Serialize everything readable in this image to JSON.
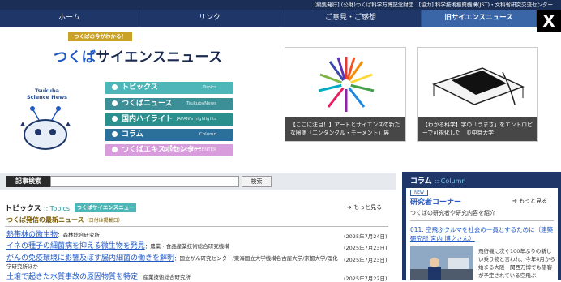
{
  "topbar": {
    "text": "[編集発行] (公財)つくば科学万博記念財団　[協力] 科学技術振興機構(JST)・文科省研究交流センター"
  },
  "nav": {
    "items": [
      "ホーム",
      "リンク",
      "ご意見・ご感想",
      "旧サイエンスニュース"
    ],
    "x_icon": "X"
  },
  "header": {
    "tagline": "つくばの今がわかる！",
    "title_a": "つくば",
    "title_b": "サイエンスニュース",
    "mascot_label_1": "Tsukuba",
    "mascot_label_2": "Science News"
  },
  "menu": [
    {
      "label": "トピックス",
      "en": "Topics"
    },
    {
      "label": "つくばニュース",
      "en": "TsukubaNews"
    },
    {
      "label": "国内ハイライト",
      "en": "JAPAN's highlights"
    },
    {
      "label": "コラム",
      "en": "Column"
    },
    {
      "label": "つくばエキスポセンター",
      "en": "TSUKUBA EXPO CENTER"
    }
  ],
  "features": [
    {
      "caption": "【ここに注目！】アートとサイエンスの新たな圏係「エンタングル・モーメント」展"
    },
    {
      "caption": "【わかる科学】字の「うまさ」をエントロピーで可視化した　©中京大学"
    }
  ],
  "search": {
    "label": "記事検索",
    "button": "検索",
    "placeholder": ""
  },
  "topics": {
    "title": "トピックス",
    "en": ":: Topics",
    "badge": "つくばサイエンスニュース",
    "more": "もっと見る",
    "subhead": "つくば発信の最新ニュース",
    "subhead_small": "（日付は掲載日）"
  },
  "news": [
    {
      "title": "熱帯林の微生物",
      "source": "：森林総合研究所",
      "date": "(2025年7月24日)"
    },
    {
      "title": "イネの種子の細菌病を抑える微生物を発見",
      "source": "：農業・食品産業技術総合研究機構",
      "date": "(2025年7月23日)"
    },
    {
      "title": "がんの免疫環境に影響及ぼす腸内細菌の働きを解明",
      "source": "：国立がん研究センター/東海国立大学機構名古屋大学/京都大学/理化学研究所ほか",
      "date": "(2025年7月23日)"
    },
    {
      "title": "土壌で起きた水質事故の原因物質を特定",
      "source": "：産業技術総合研究所",
      "date": "(2025年7月22日)"
    }
  ],
  "column": {
    "title": "コラム",
    "en": ":: Column",
    "badge": "NEW",
    "corner": "研究者コーナー",
    "more": "もっと見る",
    "sub": "つくばの研究者や研究内容を紹介",
    "link": "011. 空飛ぶクルマを社会の一員とするために（建築研究所 宮内 博之さん）",
    "text": "飛行機に次ぐ100年ぶりの新しい乗り物と言われ、今年4月から始まる大阪・関西万博でも旅客が予定されている空飛ぶ"
  }
}
